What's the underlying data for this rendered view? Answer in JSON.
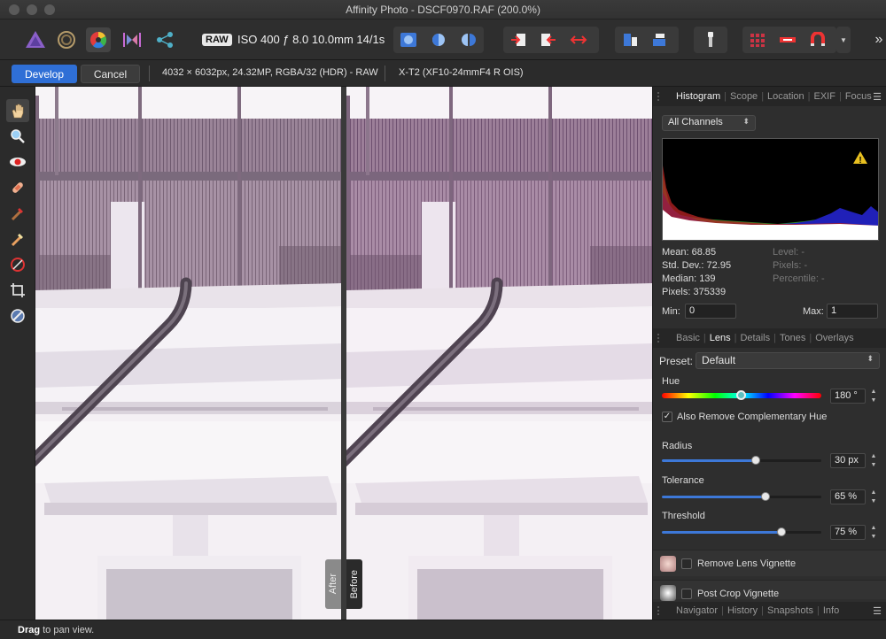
{
  "window": {
    "title": "Affinity Photo - DSCF0970.RAF (200.0%)"
  },
  "toolbar": {
    "personas": [
      {
        "name": "photo-persona-icon"
      },
      {
        "name": "liquify-persona-icon"
      },
      {
        "name": "develop-persona-icon"
      },
      {
        "name": "tone-mapping-persona-icon"
      },
      {
        "name": "export-persona-icon"
      }
    ],
    "raw_badge": "RAW",
    "exposure_info": "ISO 400 ƒ 8.0 10.0mm 14/1s",
    "overflow": "»"
  },
  "context": {
    "develop_label": "Develop",
    "cancel_label": "Cancel",
    "image_info": "4032 × 6032px, 24.32MP, RGBA/32 (HDR) - RAW",
    "camera_info": "X-T2 (XF10-24mmF4 R OIS)"
  },
  "canvas": {
    "after_label": "After",
    "before_label": "Before"
  },
  "studio": {
    "top_tabs": [
      "Histogram",
      "Scope",
      "Location",
      "EXIF",
      "Focus"
    ],
    "channel_select": "All Channels",
    "warning_glyph": "!",
    "stats": {
      "mean_label": "Mean: 68.85",
      "std_label": "Std. Dev.: 72.95",
      "median_label": "Median: 139",
      "pixels_label": "Pixels: 375339",
      "level_label": "Level: -",
      "pixels2_label": "Pixels: -",
      "percentile_label": "Percentile: -"
    },
    "min_label": "Min:",
    "min_value": "0",
    "max_label": "Max:",
    "max_value": "1",
    "develop_tabs": [
      "Basic",
      "Lens",
      "Details",
      "Tones",
      "Overlays"
    ],
    "preset_label": "Preset:",
    "preset_value": "Default",
    "hue_label": "Hue",
    "hue_value": "180 °",
    "hue_fraction": 0.5,
    "complementary_label": "Also Remove Complementary Hue",
    "complementary_checked": true,
    "radius_label": "Radius",
    "radius_value": "30 px",
    "radius_fraction": 0.59,
    "tolerance_label": "Tolerance",
    "tolerance_value": "65 %",
    "tolerance_fraction": 0.65,
    "threshold_label": "Threshold",
    "threshold_value": "75 %",
    "threshold_fraction": 0.75,
    "lens_vignette_label": "Remove Lens Vignette",
    "post_crop_label": "Post Crop Vignette",
    "bottom_tabs": [
      "Navigator",
      "History",
      "Snapshots",
      "Info"
    ]
  },
  "status": {
    "bold": "Drag",
    "text": " to pan view."
  },
  "colors": {
    "accent": "#3d78d8",
    "develop_button": "#2f6fd6",
    "panel_bg": "#2e2e2e"
  }
}
